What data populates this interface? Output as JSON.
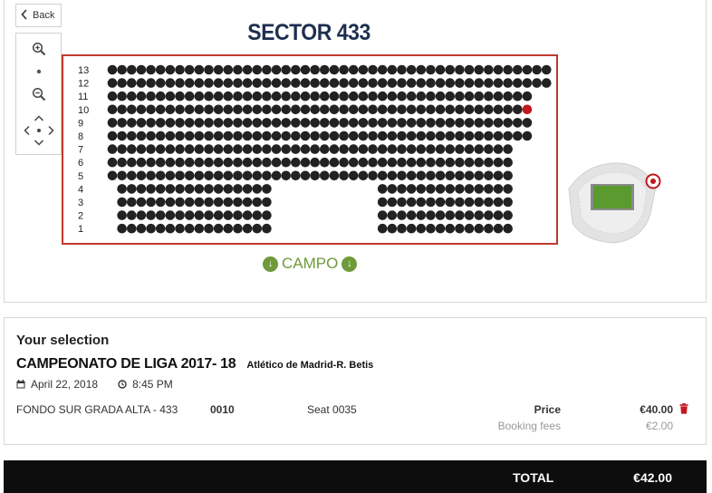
{
  "nav": {
    "back_label": "Back"
  },
  "map": {
    "sector_title": "SECTOR 433",
    "field_label": "CAMPO",
    "row_labels": [
      "13",
      "12",
      "11",
      "10",
      "9",
      "8",
      "7",
      "6",
      "5",
      "4",
      "3",
      "2",
      "1"
    ],
    "seat_color": "#222222",
    "selected_color": "#c0191f",
    "border_color": "#c0392b",
    "pitch_color": "#5a9a2e",
    "selected_seat": {
      "row": "10",
      "seat_index": 43
    }
  },
  "selection": {
    "heading": "Your selection",
    "event_title": "CAMPEONATO DE LIGA 2017- 18",
    "event_match": "Atlético de Madrid-R. Betis",
    "date": "April 22, 2018",
    "time": "8:45 PM",
    "zone": "FONDO SUR GRADA ALTA - 433",
    "row_code": "0010",
    "seat": "Seat 0035",
    "price_label": "Price",
    "price_value": "€40.00",
    "fees_label": "Booking fees",
    "fees_value": "€2.00"
  },
  "total": {
    "label": "TOTAL",
    "value": "€42.00"
  }
}
